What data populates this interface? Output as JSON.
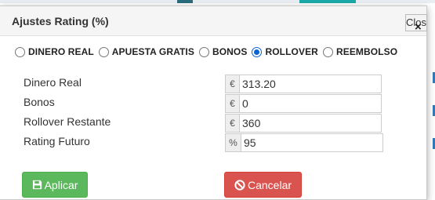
{
  "modal": {
    "title": "Ajustes Rating (%)",
    "close_label": "Close",
    "close_icon": "×"
  },
  "radio_options": [
    {
      "label": "DINERO REAL",
      "checked": false
    },
    {
      "label": "APUESTA GRATIS",
      "checked": false
    },
    {
      "label": "BONOS",
      "checked": false
    },
    {
      "label": "ROLLOVER",
      "checked": true
    },
    {
      "label": "REEMBOLSO",
      "checked": false
    }
  ],
  "fields": [
    {
      "label": "Dinero Real",
      "addon": "€",
      "value": "313.20"
    },
    {
      "label": "Bonos",
      "addon": "€",
      "value": "0"
    },
    {
      "label": "Rollover Restante",
      "addon": "€",
      "value": "360"
    },
    {
      "label": "Rating Futuro",
      "addon": "%",
      "value": "95"
    }
  ],
  "buttons": {
    "apply_label": "Aplicar",
    "cancel_label": "Cancelar"
  },
  "colors": {
    "apply": "#5cb85c",
    "cancel": "#d9534f",
    "radio_checked": "#0b63ce"
  },
  "icons": {
    "apply": "save-icon",
    "cancel": "ban-icon"
  }
}
